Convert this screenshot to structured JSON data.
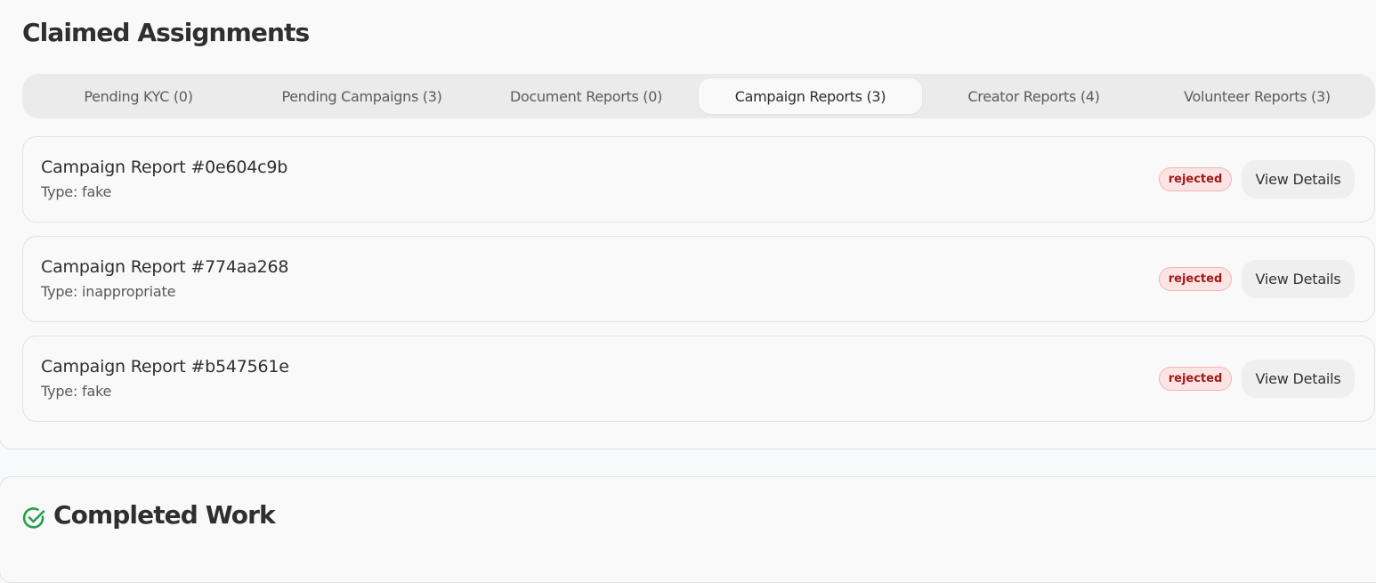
{
  "claimed": {
    "title": "Claimed Assignments",
    "tabs": [
      {
        "label": "Pending KYC (0)",
        "active": false
      },
      {
        "label": "Pending Campaigns (3)",
        "active": false
      },
      {
        "label": "Document Reports (0)",
        "active": false
      },
      {
        "label": "Campaign Reports (3)",
        "active": true
      },
      {
        "label": "Creator Reports (4)",
        "active": false
      },
      {
        "label": "Volunteer Reports (3)",
        "active": false
      }
    ],
    "reports": [
      {
        "title": "Campaign Report #0e604c9b",
        "type": "Type: fake",
        "status": "rejected",
        "action": "View Details"
      },
      {
        "title": "Campaign Report #774aa268",
        "type": "Type: inappropriate",
        "status": "rejected",
        "action": "View Details"
      },
      {
        "title": "Campaign Report #b547561e",
        "type": "Type: fake",
        "status": "rejected",
        "action": "View Details"
      }
    ]
  },
  "completed": {
    "title": "Completed Work",
    "icon": "check-circle-icon"
  },
  "colors": {
    "rejected_bg": "#fde4e4",
    "rejected_text": "#a01818",
    "completed_icon": "#22a04b"
  }
}
